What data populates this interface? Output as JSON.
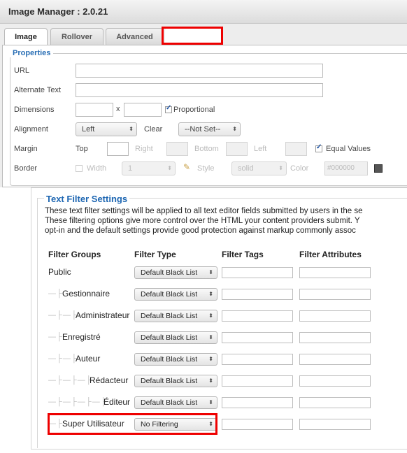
{
  "image_manager": {
    "title": "Image Manager : 2.0.21",
    "tabs": [
      {
        "label": "Image",
        "active": true
      },
      {
        "label": "Rollover",
        "active": false
      },
      {
        "label": "Advanced",
        "active": false
      },
      {
        "label": "",
        "active": false
      }
    ],
    "properties": {
      "legend": "Properties",
      "url_label": "URL",
      "url_value": "",
      "alt_label": "Alternate Text",
      "alt_value": "",
      "dimensions_label": "Dimensions",
      "dimensions_x": "x",
      "width_value": "",
      "height_value": "",
      "proportional_label": "Proportional",
      "proportional_checked": true,
      "alignment_label": "Alignment",
      "alignment_value": "Left",
      "clear_label": "Clear",
      "clear_value": "--Not Set--",
      "margin_label": "Margin",
      "margin_top_label": "Top",
      "margin_right_label": "Right",
      "margin_bottom_label": "Bottom",
      "margin_left_label": "Left",
      "equal_values_label": "Equal Values",
      "equal_values_checked": true,
      "border_label": "Border",
      "border_width_label": "Width",
      "border_width_value": "1",
      "border_style_label": "Style",
      "border_style_value": "solid",
      "border_color_label": "Color",
      "border_color_value": "#000000",
      "border_checked": false
    }
  },
  "text_filter": {
    "title": "Text Filter Settings",
    "description": [
      "These text filter settings will be applied to all text editor fields submitted by users in the se",
      "These filtering options give more control over the HTML your content providers submit. Y",
      "opt-in and the default settings provide good protection against markup commonly assoc"
    ],
    "headers": {
      "groups": "Filter Groups",
      "type": "Filter Type",
      "tags": "Filter Tags",
      "attributes": "Filter Attributes"
    },
    "rows": [
      {
        "name": "Public",
        "tree": "",
        "filter": "Default Black List"
      },
      {
        "name": "Gestionnaire",
        "tree": "— ├",
        "filter": "Default Black List"
      },
      {
        "name": "Administrateur",
        "tree": "— ├ — ├",
        "filter": "Default Black List"
      },
      {
        "name": "Enregistré",
        "tree": "— ├",
        "filter": "Default Black List"
      },
      {
        "name": "Auteur",
        "tree": "— ├ — ├",
        "filter": "Default Black List"
      },
      {
        "name": "Rédacteur",
        "tree": "— ├ — ├ — ├",
        "filter": "Default Black List"
      },
      {
        "name": "Éditeur",
        "tree": "— ├ — ├ — ├ — ├",
        "filter": "Default Black List"
      },
      {
        "name": "Super Utilisateur",
        "tree": "— ├",
        "filter": "No Filtering"
      }
    ]
  },
  "colors": {
    "accent_blue": "#1d66b2",
    "highlight_red": "#ee0000",
    "border_color_swatch": "#555555"
  }
}
